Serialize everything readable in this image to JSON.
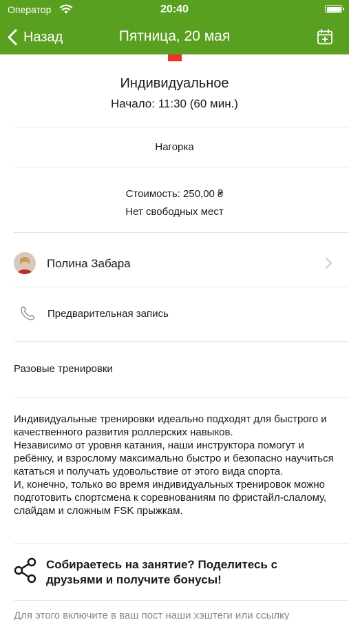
{
  "status_bar": {
    "carrier": "Оператор",
    "time": "20:40"
  },
  "nav": {
    "back_label": "Назад",
    "title": "Пятница, 20 мая"
  },
  "colors": {
    "accent": "#5aa020",
    "marker": "#e8362a"
  },
  "event": {
    "name": "Индивидуальное",
    "start": "Начало: 11:30 (60 мин.)",
    "location": "Нагорка",
    "price": "Стоимость: 250,00 ₴",
    "availability": "Нет свободных мест"
  },
  "trainer": {
    "name": "Полина Забара"
  },
  "booking": {
    "label": "Предварительная запись"
  },
  "category": "Разовые тренировки",
  "description": "Индивидуальные тренировки идеально подходят для быстрого и качественного развития роллерских навыков.\nНезависимо от уровня катания, наши инструктора помогут и ребёнку, и взрослому максимально быстро и безопасно научиться кататься и получать удовольствие от этого вида спорта.\nИ, конечно, только во время индивидуальных тренировок можно подготовить спортсмена к соревнованиям по фристайл-слалому, слайдам и сложным FSK прыжкам.",
  "share": {
    "text": "Собираетесь на занятие? Поделитесь с друзьями и получите бонусы!"
  },
  "hint": "Для этого включите в ваш пост наши хэштеги или ссылку",
  "icons": [
    "wifi-icon",
    "battery-icon",
    "back-chevron-icon",
    "calendar-add-icon",
    "chevron-right-icon",
    "phone-icon",
    "share-icon"
  ]
}
